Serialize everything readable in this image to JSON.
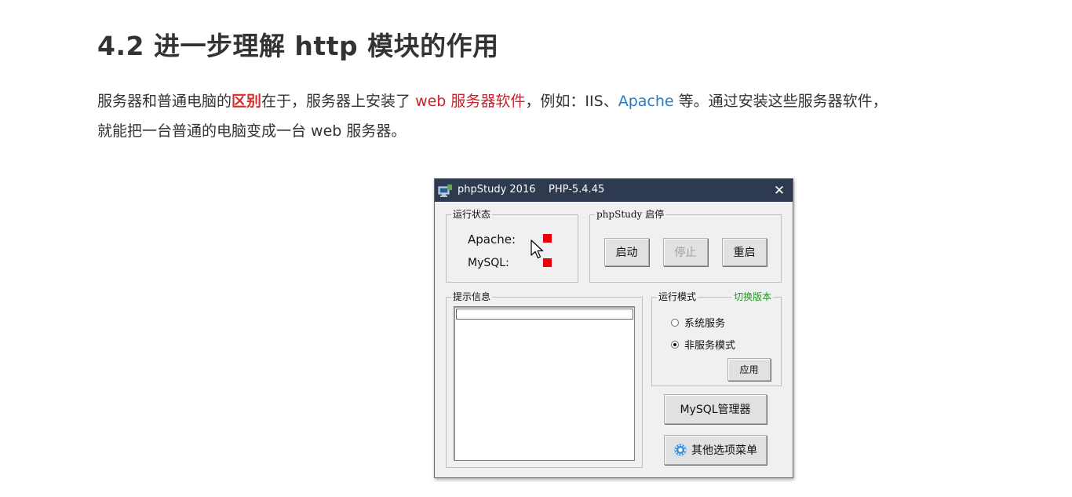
{
  "doc": {
    "title": "4.2 进一步理解 http 模块的作用",
    "para": {
      "p1": "服务器和普通电脑的",
      "hl1": "区别",
      "p2": "在于，服务器上安装了 ",
      "hl2": "web 服务器软件",
      "p3": "，例如：IIS、",
      "hl3": "Apache",
      "p4": " 等。通过安装这些服务器软件，",
      "p5": "就能把一台普通的电脑变成一台 web 服务器。"
    }
  },
  "window": {
    "title": "phpStudy 2016    PHP-5.4.45",
    "close_glyph": "✕",
    "app_icon": "phpstudy-icon",
    "status_group": {
      "label": "运行状态",
      "apache_label": "Apache:",
      "mysql_label": "MySQL:",
      "apache_status_color": "#e8000b",
      "mysql_status_color": "#e8000b"
    },
    "control_group": {
      "label": "phpStudy 启停",
      "start": "启动",
      "stop": "停止",
      "restart": "重启"
    },
    "info_group": {
      "label": "提示信息"
    },
    "mode_group": {
      "label": "运行模式",
      "switch_link": "切换版本",
      "option_service": "系统服务",
      "option_nonservice": "非服务模式",
      "selected": "非服务模式",
      "apply": "应用"
    },
    "mysql_manager": "MySQL管理器",
    "other_menu": "其他选项菜单",
    "other_menu_icon": "gear-icon"
  },
  "colors": {
    "titlebar": "#2d3a4f",
    "highlight_red": "#c8232c",
    "highlight_blue": "#2a7bc0",
    "link_green": "#1a9a1a"
  }
}
